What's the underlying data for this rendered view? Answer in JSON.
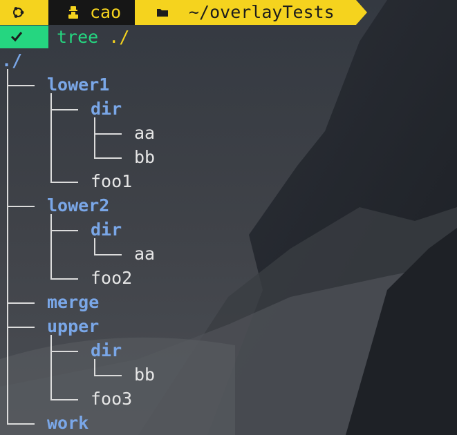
{
  "prompt": {
    "user": "cao",
    "path": "~/overlayTests",
    "command": "tree",
    "argument": "./"
  },
  "tree": {
    "root": "./",
    "nodes": [
      {
        "name": "lower1",
        "type": "dir",
        "depth": 1
      },
      {
        "name": "dir",
        "type": "dir",
        "depth": 2
      },
      {
        "name": "aa",
        "type": "file",
        "depth": 3
      },
      {
        "name": "bb",
        "type": "file",
        "depth": 3
      },
      {
        "name": "foo1",
        "type": "file",
        "depth": 2
      },
      {
        "name": "lower2",
        "type": "dir",
        "depth": 1
      },
      {
        "name": "dir",
        "type": "dir",
        "depth": 2
      },
      {
        "name": "aa",
        "type": "file",
        "depth": 3
      },
      {
        "name": "foo2",
        "type": "file",
        "depth": 2
      },
      {
        "name": "merge",
        "type": "dir",
        "depth": 1
      },
      {
        "name": "upper",
        "type": "dir",
        "depth": 1
      },
      {
        "name": "dir",
        "type": "dir",
        "depth": 2
      },
      {
        "name": "bb",
        "type": "file",
        "depth": 3
      },
      {
        "name": "foo3",
        "type": "file",
        "depth": 2
      },
      {
        "name": "work",
        "type": "dir",
        "depth": 1
      }
    ]
  },
  "colors": {
    "prompt_yellow": "#f5d31e",
    "prompt_dark": "#161616",
    "status_green": "#25d680",
    "dir_blue": "#7aa7e8",
    "file_white": "#e6e6e6"
  },
  "icons": {
    "os": "ubuntu-icon",
    "user": "user-icon",
    "path": "folder-icon",
    "status": "check-icon"
  }
}
